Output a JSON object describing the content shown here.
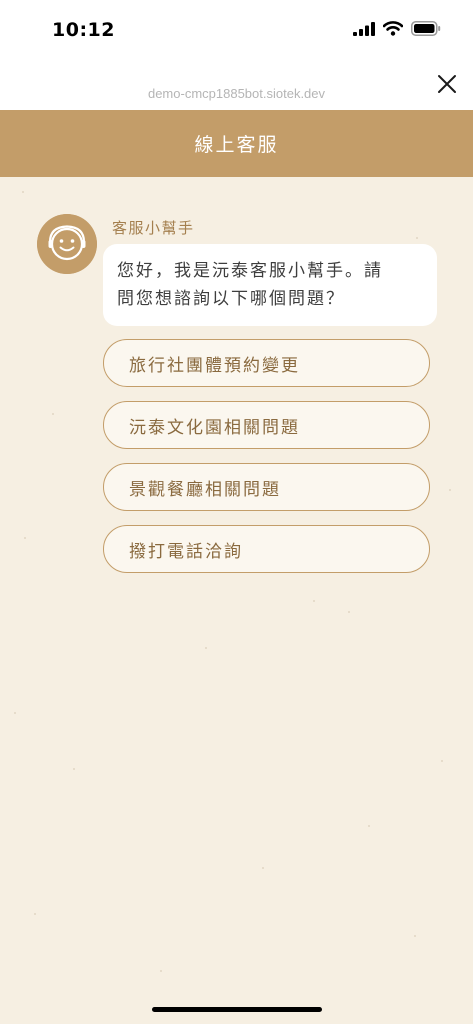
{
  "status_bar": {
    "time": "10:12"
  },
  "browser": {
    "url": "demo-cmcp1885bot.siotek.dev",
    "close_icon": "close-icon"
  },
  "header": {
    "title": "線上客服"
  },
  "chat": {
    "bot_name": "客服小幫手",
    "message_line1": "您好，我是沅泰客服小幫手。請",
    "message_line2": "問您想諮詢以下哪個問題？",
    "options": [
      {
        "label": "旅行社團體預約變更"
      },
      {
        "label": "沅泰文化園相關問題"
      },
      {
        "label": "景觀餐廳相關問題"
      },
      {
        "label": "撥打電話洽詢"
      }
    ]
  },
  "colors": {
    "header": "#c39d69",
    "background": "#f6efe2",
    "accent_text": "#8a6a3f"
  }
}
